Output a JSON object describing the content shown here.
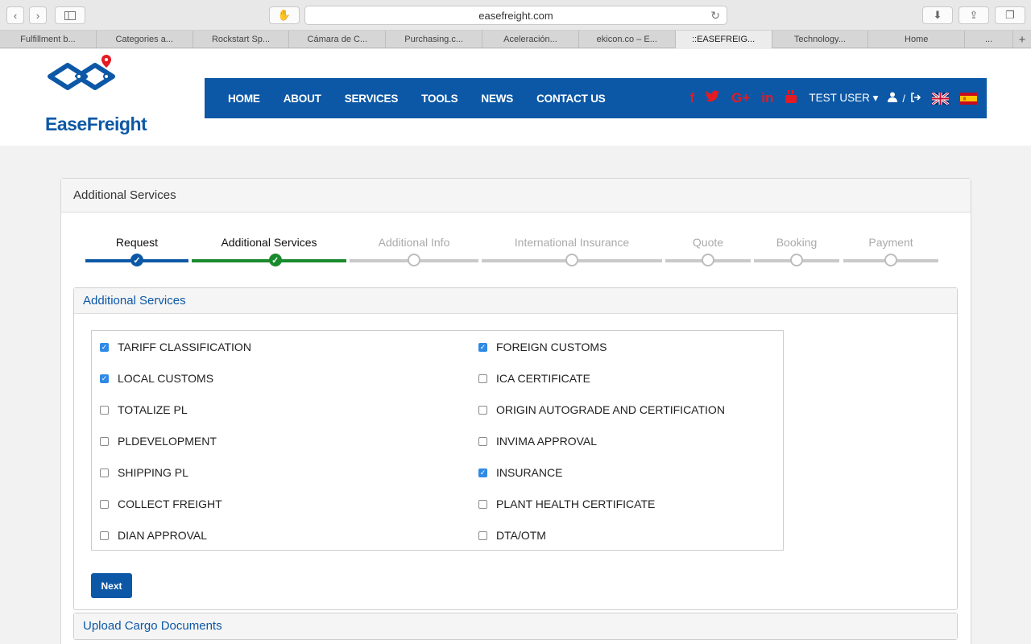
{
  "browser": {
    "url": "easefreight.com",
    "tabs": [
      {
        "label": "Fulfillment b..."
      },
      {
        "label": "Categories a..."
      },
      {
        "label": "Rockstart Sp..."
      },
      {
        "label": "Cámara de C..."
      },
      {
        "label": "Purchasing.c..."
      },
      {
        "label": "Aceleración..."
      },
      {
        "label": "ekicon.co – E..."
      },
      {
        "label": "::EASEFREIG..."
      },
      {
        "label": "Technology..."
      },
      {
        "label": "Home"
      },
      {
        "label": "..."
      }
    ]
  },
  "site": {
    "logo_text": "EaseFreight",
    "nav": [
      "HOME",
      "ABOUT",
      "SERVICES",
      "TOOLS",
      "NEWS",
      "CONTACT US"
    ],
    "user_label": "TEST USER",
    "social_icons": [
      "f",
      "t",
      "G+",
      "in",
      "yt"
    ],
    "colors": {
      "brand": "#0c58a6",
      "social": "#e41b23",
      "done": "#0c58a6",
      "current": "#1a8a2e"
    }
  },
  "panel": {
    "title": "Additional Services",
    "steps": [
      {
        "label": "Request",
        "state": "done"
      },
      {
        "label": "Additional Services",
        "state": "current"
      },
      {
        "label": "Additional Info",
        "state": "todo"
      },
      {
        "label": "International Insurance",
        "state": "todo"
      },
      {
        "label": "Quote",
        "state": "todo"
      },
      {
        "label": "Booking",
        "state": "todo"
      },
      {
        "label": "Payment",
        "state": "todo"
      }
    ],
    "section_title": "Additional Services",
    "services_left": [
      {
        "label": "TARIFF CLASSIFICATION",
        "checked": true
      },
      {
        "label": "LOCAL CUSTOMS",
        "checked": true
      },
      {
        "label": "TOTALIZE PL",
        "checked": false
      },
      {
        "label": "PLDEVELOPMENT",
        "checked": false
      },
      {
        "label": "SHIPPING PL",
        "checked": false
      },
      {
        "label": "COLLECT FREIGHT",
        "checked": false
      },
      {
        "label": "DIAN APPROVAL",
        "checked": false
      }
    ],
    "services_right": [
      {
        "label": "FOREIGN CUSTOMS",
        "checked": true
      },
      {
        "label": "ICA CERTIFICATE",
        "checked": false
      },
      {
        "label": "ORIGIN AUTOGRADE AND CERTIFICATION",
        "checked": false
      },
      {
        "label": "INVIMA APPROVAL",
        "checked": false
      },
      {
        "label": "INSURANCE",
        "checked": true
      },
      {
        "label": "PLANT HEALTH CERTIFICATE",
        "checked": false
      },
      {
        "label": "DTA/OTM",
        "checked": false
      }
    ],
    "next_label": "Next",
    "next_section_title": "Upload Cargo Documents"
  }
}
